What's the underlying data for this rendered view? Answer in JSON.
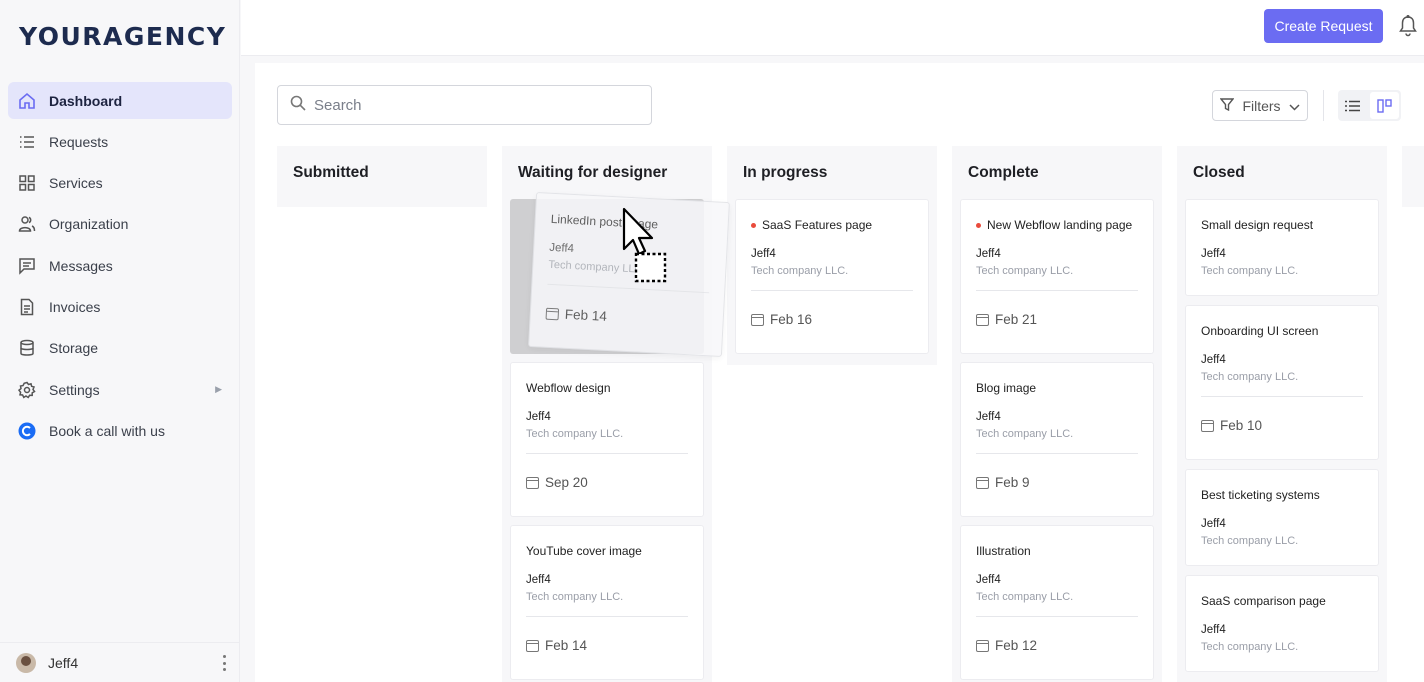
{
  "brand": {
    "logo_text": "YOURAGENCY"
  },
  "sidebar": {
    "items": [
      {
        "label": "Dashboard",
        "icon": "home-icon",
        "active": true
      },
      {
        "label": "Requests",
        "icon": "list-icon"
      },
      {
        "label": "Services",
        "icon": "grid-icon"
      },
      {
        "label": "Organization",
        "icon": "users-icon"
      },
      {
        "label": "Messages",
        "icon": "message-icon"
      },
      {
        "label": "Invoices",
        "icon": "invoice-icon"
      },
      {
        "label": "Storage",
        "icon": "database-icon"
      },
      {
        "label": "Settings",
        "icon": "gear-icon",
        "has_submenu": true
      },
      {
        "label": "Book a call with us",
        "icon": "calendly-icon"
      }
    ],
    "user": {
      "name": "Jeff4"
    }
  },
  "topbar": {
    "create_label": "Create Request"
  },
  "toolbar": {
    "search_placeholder": "Search",
    "filters_label": "Filters"
  },
  "accent_color": "#6b6cf2",
  "board": {
    "columns": [
      {
        "title": "Submitted",
        "cards": []
      },
      {
        "title": "Waiting for designer",
        "cards": [
          {
            "title": "LinkedIn post image",
            "user": "Jeff4",
            "company": "Tech company LLC.",
            "date": "Feb 14",
            "dragging": true
          },
          {
            "title": "Webflow design",
            "user": "Jeff4",
            "company": "Tech company LLC.",
            "date": "Sep 20"
          },
          {
            "title": "YouTube cover image",
            "user": "Jeff4",
            "company": "Tech company LLC.",
            "date": "Feb 14"
          }
        ]
      },
      {
        "title": "In progress",
        "cards": [
          {
            "title": "SaaS Features page",
            "user": "Jeff4",
            "company": "Tech company LLC.",
            "date": "Feb 16",
            "unread": true
          }
        ]
      },
      {
        "title": "Complete",
        "cards": [
          {
            "title": "New Webflow landing page",
            "user": "Jeff4",
            "company": "Tech company LLC.",
            "date": "Feb 21",
            "unread": true
          },
          {
            "title": "Blog image",
            "user": "Jeff4",
            "company": "Tech company LLC.",
            "date": "Feb 9"
          },
          {
            "title": "Illustration",
            "user": "Jeff4",
            "company": "Tech company LLC.",
            "date": "Feb 12"
          }
        ]
      },
      {
        "title": "Closed",
        "cards": [
          {
            "title": "Small design request",
            "user": "Jeff4",
            "company": "Tech company LLC."
          },
          {
            "title": "Onboarding UI screen",
            "user": "Jeff4",
            "company": "Tech company LLC.",
            "date": "Feb 10"
          },
          {
            "title": "Best ticketing systems",
            "user": "Jeff4",
            "company": "Tech company LLC."
          },
          {
            "title": "SaaS comparison page",
            "user": "Jeff4",
            "company": "Tech company LLC."
          }
        ]
      }
    ]
  }
}
